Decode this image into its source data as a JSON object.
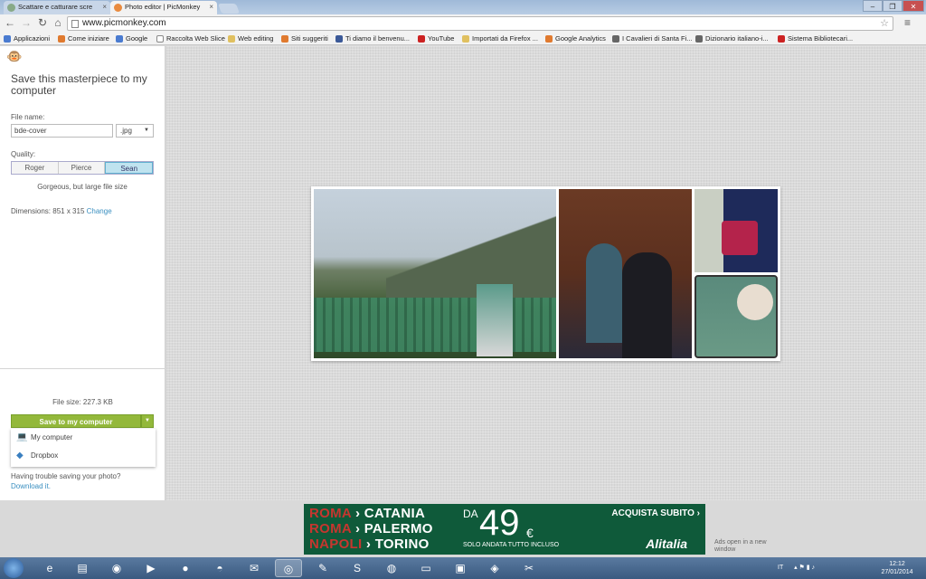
{
  "browser": {
    "tabs": [
      {
        "label": "Scattare e catturare scre"
      },
      {
        "label": "Photo editor | PicMonkey"
      }
    ],
    "url": "www.picmonkey.com",
    "bookmarks": [
      {
        "label": "Applicazioni",
        "color": "#4a7bd0"
      },
      {
        "label": "Come iniziare",
        "color": "#e07a2f"
      },
      {
        "label": "Google",
        "color": "#4a7bd0"
      },
      {
        "label": "Raccolta Web Slice",
        "color": "#888888"
      },
      {
        "label": "Web editing",
        "color": "#e0c060"
      },
      {
        "label": "Siti suggeriti",
        "color": "#e07a2f"
      },
      {
        "label": "Ti diamo il benvenu...",
        "color": "#3b5998"
      },
      {
        "label": "YouTube",
        "color": "#cc2222"
      },
      {
        "label": "Importati da Firefox ...",
        "color": "#e0c060"
      },
      {
        "label": "Google Analytics",
        "color": "#e07a2f"
      },
      {
        "label": "I Cavalieri di Santa Fi...",
        "color": "#666666"
      },
      {
        "label": "Dizionario italiano-i...",
        "color": "#666666"
      },
      {
        "label": "Sistema Bibliotecari...",
        "color": "#cc2222"
      }
    ]
  },
  "panel": {
    "title": "Save this masterpiece to my computer",
    "file_name_label": "File name:",
    "file_name_value": "bde-cover",
    "format_value": ".jpg",
    "quality_label": "Quality:",
    "quality_options": [
      "Roger",
      "Pierce",
      "Sean"
    ],
    "quality_selected": "Sean",
    "quality_desc": "Gorgeous, but large file size",
    "dimensions_label": "Dimensions:",
    "dimensions_value": "851 x 315",
    "dimensions_change": "Change",
    "file_size": "File size: 227.3 KB",
    "save_button": "Save to my computer",
    "save_menu": [
      {
        "label": "My computer",
        "icon": "laptop-icon"
      },
      {
        "label": "Dropbox",
        "icon": "dropbox-icon"
      }
    ],
    "trouble_text": "Having trouble saving your photo?",
    "download_link": "Download it."
  },
  "ad": {
    "routes": [
      {
        "from": "ROMA",
        "to": "CATANIA"
      },
      {
        "from": "ROMA",
        "to": "PALERMO"
      },
      {
        "from": "NAPOLI",
        "to": "TORINO"
      }
    ],
    "da": "DA",
    "price": "49",
    "currency": "€",
    "subtitle": "SOLO ANDATA TUTTO INCLUSO",
    "cta": "ACQUISTA SUBITO ›",
    "brand": "Alitalia",
    "note": "Ads open in a new window"
  },
  "taskbar": {
    "language": "IT",
    "time": "12:12",
    "date": "27/01/2014"
  }
}
